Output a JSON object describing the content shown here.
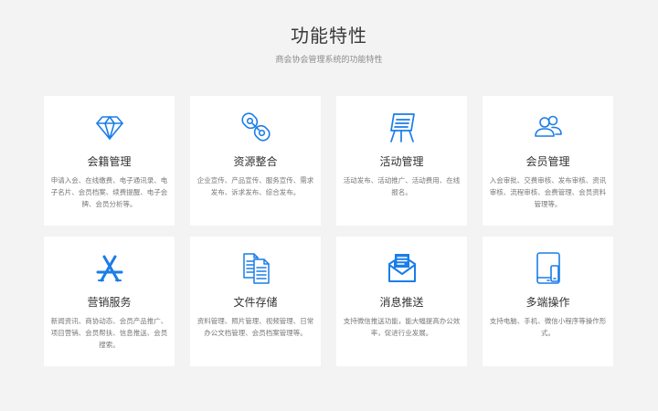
{
  "header": {
    "title": "功能特性",
    "subtitle": "商会协会管理系统的功能特性"
  },
  "theme": {
    "accent": "#1a7de8"
  },
  "features": [
    {
      "icon": "diamond-icon",
      "title": "会籍管理",
      "desc": "申请入会、在线缴费、电子通讯录、电子名片、会员档案、续费提醒、电子会牌、会员分析等。"
    },
    {
      "icon": "chain-link-icon",
      "title": "资源整合",
      "desc": "企业宣传、产品宣传、服务宣传、需求发布、诉求发布、综合发布。"
    },
    {
      "icon": "easel-board-icon",
      "title": "活动管理",
      "desc": "活动发布、活动推广、活动费用、在线报名。"
    },
    {
      "icon": "members-icon",
      "title": "会员管理",
      "desc": "入会审批、交费审核、发布审核、资讯审核、流程审核、会费管理、会员资料管理等。"
    },
    {
      "icon": "app-store-icon",
      "title": "营销服务",
      "desc": "新闻资讯、商协动态、会员产品推广、项目营销、会员帮扶、信息推送、会员搜索。"
    },
    {
      "icon": "documents-icon",
      "title": "文件存储",
      "desc": "资料管理、照片管理、视频管理、日常办公文档管理、会员档案管理等。"
    },
    {
      "icon": "envelope-icon",
      "title": "消息推送",
      "desc": "支持微信推送功能，能大幅提高办公效率，促进行业发展。"
    },
    {
      "icon": "devices-icon",
      "title": "多端操作",
      "desc": "支持电脑、手机、微信小程序等操作形式。"
    }
  ]
}
